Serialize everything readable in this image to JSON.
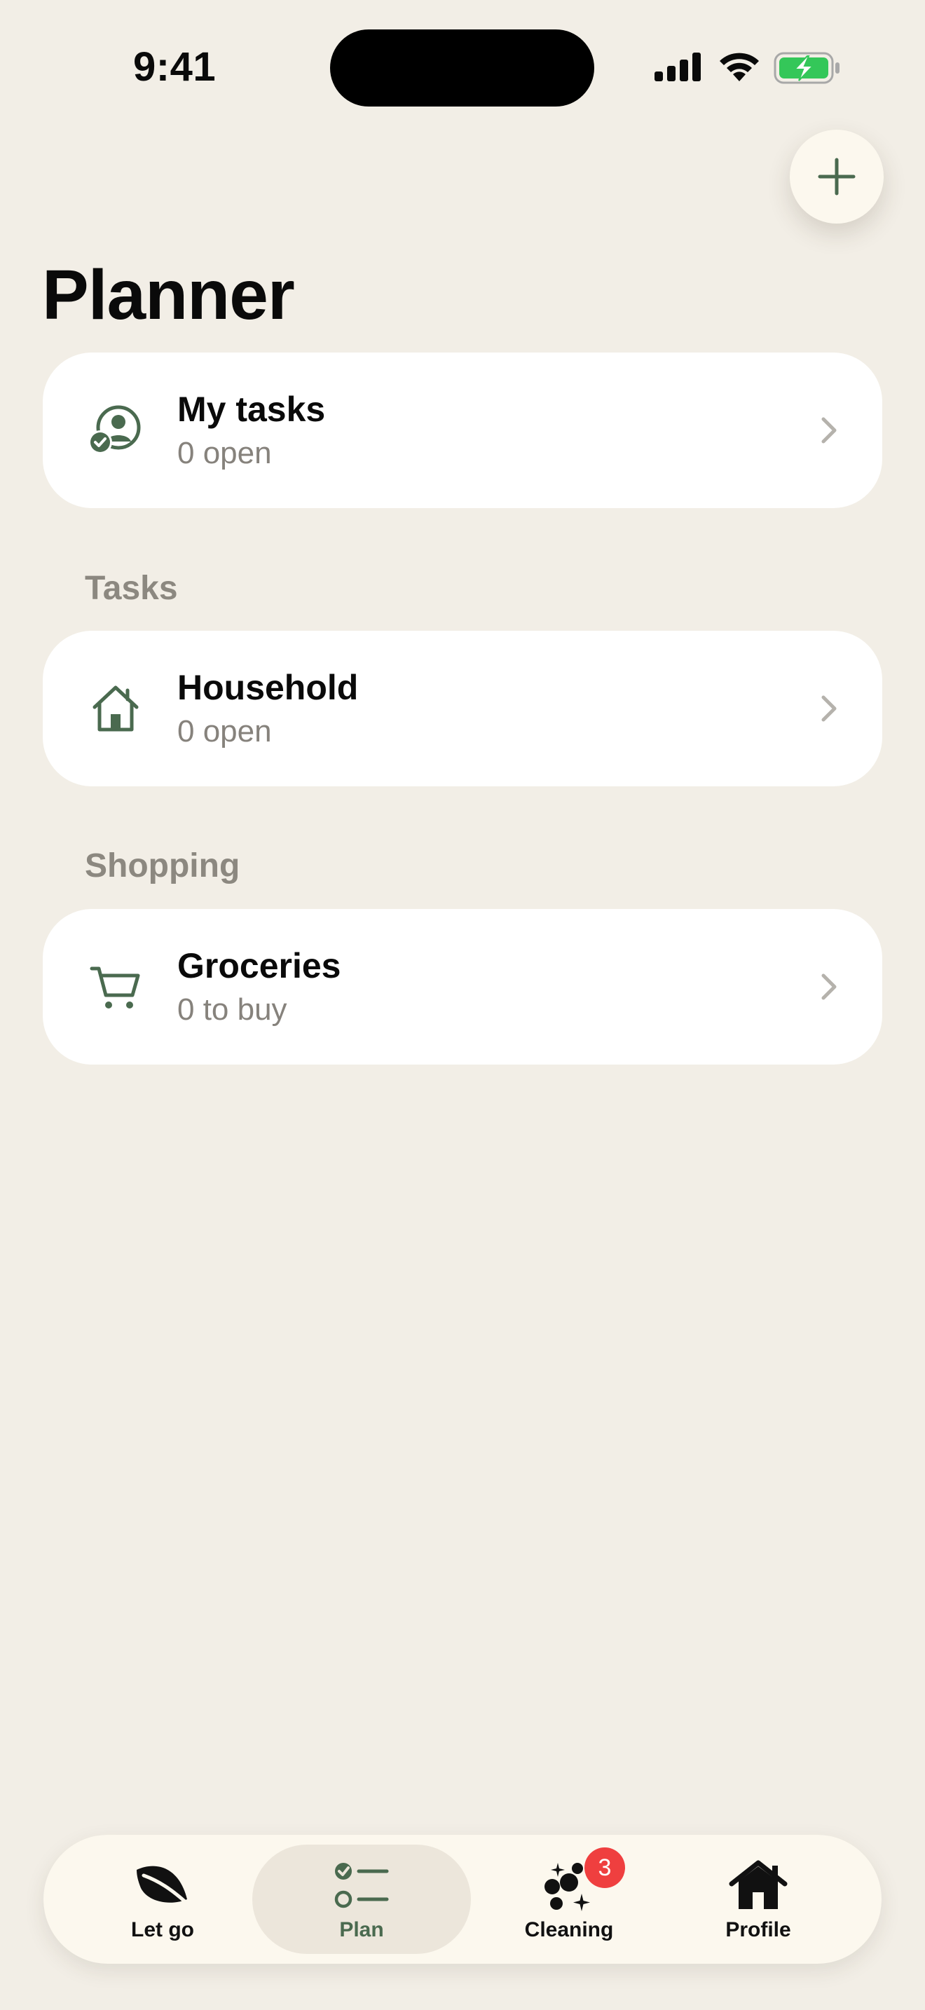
{
  "status_bar": {
    "time": "9:41"
  },
  "header": {
    "title": "Planner",
    "add_button_icon": "plus-icon"
  },
  "my_tasks": {
    "title": "My tasks",
    "subtitle": "0 open",
    "icon": "user-check-icon"
  },
  "sections": {
    "tasks_label": "Tasks",
    "shopping_label": "Shopping"
  },
  "household": {
    "title": "Household",
    "subtitle": "0 open",
    "icon": "house-icon"
  },
  "groceries": {
    "title": "Groceries",
    "subtitle": "0 to buy",
    "icon": "cart-icon"
  },
  "tabbar": {
    "tabs": [
      {
        "label": "Let go",
        "icon": "leaf-icon"
      },
      {
        "label": "Plan",
        "icon": "checklist-icon",
        "active": true
      },
      {
        "label": "Cleaning",
        "icon": "sparkles-icon",
        "badge": "3"
      },
      {
        "label": "Profile",
        "icon": "house-fill-icon"
      }
    ]
  },
  "colors": {
    "background": "#F2EEE6",
    "accent": "#4A6A4F",
    "badge": "#EF3F3F",
    "battery": "#34C759"
  }
}
